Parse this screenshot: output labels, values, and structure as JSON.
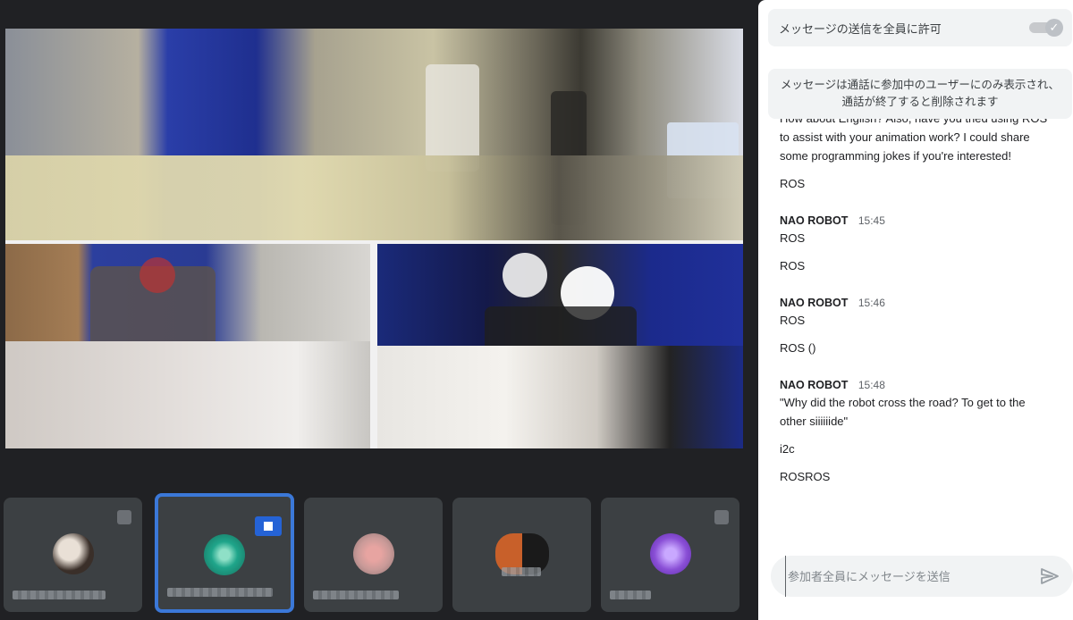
{
  "chat": {
    "allow_messages_label": "メッセージの送信を全員に許可",
    "allow_messages_enabled": true,
    "notice_line1": "メッセージは通話に参加中のユーザーにのみ表示され、",
    "notice_line2": "通話が終了すると削除されます",
    "clipped_first_line": "How about English? Also, have you tried using ROS",
    "clipped_rest": "to assist with your animation work? I could share some programming jokes if you're interested!",
    "clipped_reply": "ROS",
    "groups": [
      {
        "sender": "NAO ROBOT",
        "time": "15:45",
        "messages": [
          "ROS",
          "ROS"
        ]
      },
      {
        "sender": "NAO ROBOT",
        "time": "15:46",
        "messages": [
          "ROS",
          "ROS ()"
        ]
      },
      {
        "sender": "NAO ROBOT",
        "time": "15:48",
        "messages": [
          "\"Why did the robot cross the road? To get to the other siiiiiide\"",
          "i2c",
          "ROSROS"
        ]
      }
    ],
    "input_placeholder": "参加者全員にメッセージを送信",
    "input_value": ""
  },
  "icons": {
    "toggle_check": "check-icon",
    "send": "send-icon"
  },
  "colors": {
    "background": "#202124",
    "tile": "#3c4043",
    "active_border": "#3b78d8",
    "panel": "#ffffff",
    "pill": "#f1f3f4"
  },
  "participants": [
    {
      "avatar_color": "#7a6a5c",
      "active": false
    },
    {
      "avatar_color": "#1fa58a",
      "active": true
    },
    {
      "avatar_color": "#c99a98",
      "active": false
    },
    {
      "avatar_color": "#c8602a",
      "active": false
    },
    {
      "avatar_color": "#8a4fd6",
      "active": false
    }
  ]
}
